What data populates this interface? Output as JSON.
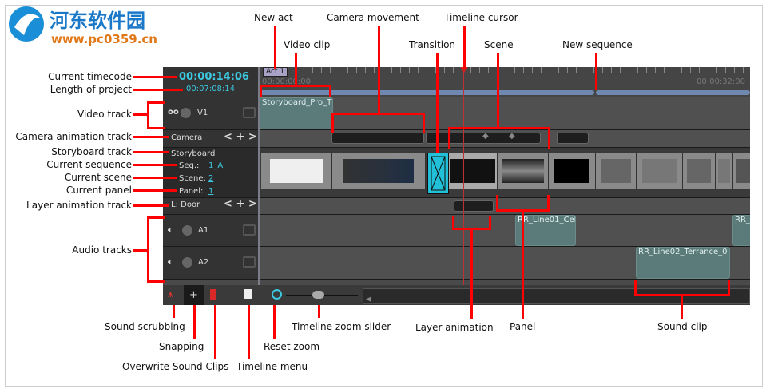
{
  "watermark": {
    "name": "河东软件园",
    "url": "www.pc0359.cn"
  },
  "timeline": {
    "current_timecode": "00:00:14:06",
    "project_length": "00:07:08:14",
    "ruler_start": "00:00:00:00",
    "ruler_end": "00:00:32:00",
    "act_label": "Act 1",
    "tracks": {
      "video": {
        "name": "V1",
        "clip": "Storyboard_Pro_T"
      },
      "camera": {
        "name": "Camera"
      },
      "storyboard": {
        "name": "Storyboard",
        "seq_label": "Seq.:",
        "seq_value": "1_A",
        "scene_label": "Scene:",
        "scene_value": "2",
        "panel_label": "Panel:",
        "panel_value": "1"
      },
      "layer": {
        "name": "L: Door"
      },
      "audio": [
        {
          "name": "A1",
          "clips": [
            "RR_Line01_Cel",
            "RR_"
          ]
        },
        {
          "name": "A2",
          "clips": [
            "RR_Line02_Terrance_0"
          ]
        }
      ]
    },
    "nav_controls": {
      "prev": "<",
      "add": "+",
      "next": ">"
    }
  },
  "annotations": {
    "current_timecode": "Current timecode",
    "length_of_project": "Length of project",
    "video_track": "Video track",
    "camera_animation_track": "Camera animation track",
    "storyboard_track": "Storyboard track",
    "current_sequence": "Current sequence",
    "current_scene": "Current scene",
    "current_panel": "Current panel",
    "layer_animation_track": "Layer animation track",
    "audio_tracks": "Audio tracks",
    "new_act": "New act",
    "video_clip": "Video clip",
    "camera_movement": "Camera movement",
    "transition": "Transition",
    "timeline_cursor": "Timeline cursor",
    "scene": "Scene",
    "new_sequence": "New sequence",
    "sound_scrubbing": "Sound scrubbing",
    "snapping": "Snapping",
    "overwrite_sound_clips": "Overwrite Sound Clips",
    "timeline_menu": "Timeline menu",
    "reset_zoom": "Reset zoom",
    "timeline_zoom_slider": "Timeline zoom slider",
    "layer_animation": "Layer animation",
    "panel": "Panel",
    "sound_clip": "Sound clip"
  },
  "colors": {
    "annotation": "#ff0000",
    "accent": "#3cc8e0",
    "clip": "#5b7b7b",
    "sequence_bar": "#6f88b0",
    "transition": "#22c0d8"
  }
}
